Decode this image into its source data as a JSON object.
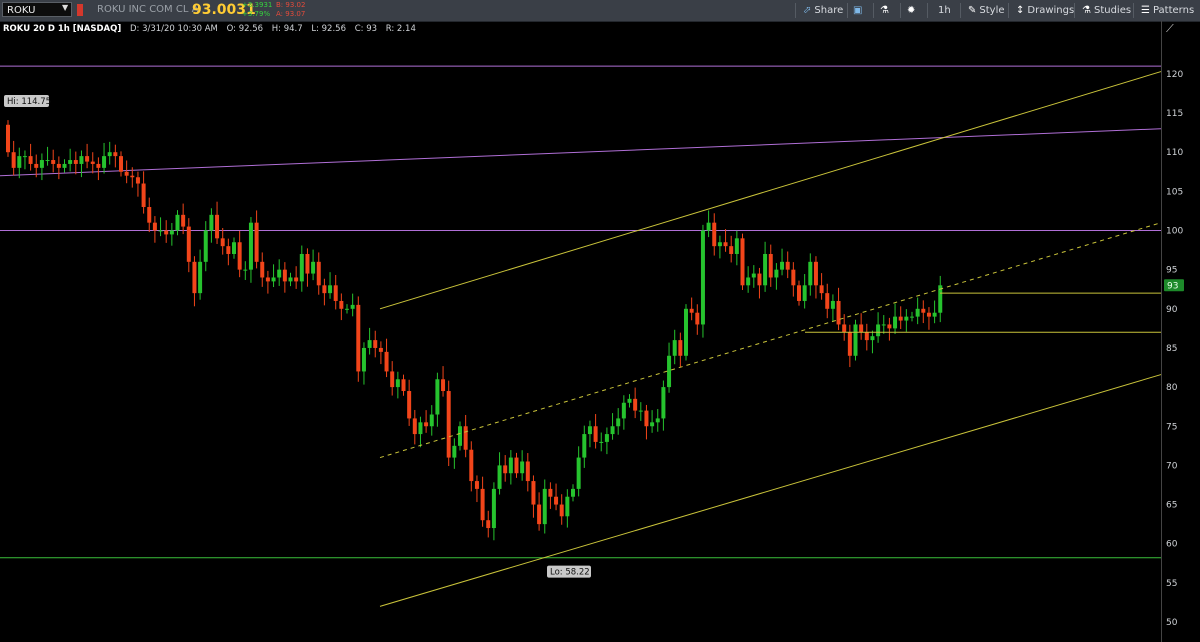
{
  "toolbar": {
    "symbol": "ROKU",
    "company": "ROKU INC COM CL A",
    "last_price": "93.0031",
    "change": "+3.3931",
    "change_pct": "+3.79%",
    "bid": "B: 93.02",
    "ask": "A: 93.07",
    "buttons": {
      "share": "Share",
      "timeframe": "1h",
      "style": "Style",
      "drawings": "Drawings",
      "studies": "Studies",
      "patterns": "Patterns"
    }
  },
  "infobar": {
    "title": "ROKU 20 D 1h [NASDAQ]",
    "date": "D: 3/31/20 10:30 AM",
    "open": "O: 92.56",
    "high": "H: 94.7",
    "low": "L: 92.56",
    "close": "C: 93",
    "range": "R: 2.14"
  },
  "colors": {
    "up": "#26c32e",
    "down": "#f2451a",
    "purple": "#b06fd6",
    "yellow": "#c9c33a",
    "green_line": "#3bbf3b"
  },
  "chart_data": {
    "type": "candlestick",
    "ylim": [
      48,
      124
    ],
    "y_ticks": [
      "50",
      "55",
      "60",
      "65",
      "70",
      "75",
      "80",
      "85",
      "90",
      "95",
      "100",
      "105",
      "110",
      "115",
      "120"
    ],
    "price_label": "93",
    "hi_label": "Hi: 114.75",
    "lo_label": "Lo: 58.22",
    "close": [
      110,
      108,
      109.5,
      109.5,
      108.5,
      108,
      109,
      109,
      108.5,
      108,
      108.5,
      109,
      108.5,
      109.5,
      108.8,
      108.5,
      108,
      109.5,
      110,
      109.5,
      107.5,
      107,
      106.8,
      106,
      103,
      101,
      100,
      100,
      99.5,
      100,
      102,
      100.5,
      96,
      92,
      96,
      100,
      102,
      99,
      98,
      97,
      98.5,
      95,
      95,
      101,
      96,
      94,
      93.5,
      94,
      95,
      93.5,
      94,
      93.5,
      97,
      94.5,
      96,
      93,
      92,
      93,
      91,
      90,
      90,
      90.5,
      82,
      85,
      86,
      85,
      84.5,
      82,
      80,
      81,
      79.5,
      76,
      74,
      75.5,
      75,
      76.5,
      81,
      79.5,
      71,
      72.5,
      75,
      72,
      68,
      67,
      63,
      62,
      67,
      70,
      69,
      71,
      69,
      70.5,
      68,
      65,
      62.5,
      67,
      66,
      65,
      63.5,
      66,
      67,
      71,
      74,
      75,
      73,
      73,
      74,
      75,
      76,
      78,
      78.5,
      77,
      77,
      75,
      75.5,
      76,
      80,
      84,
      86,
      84,
      90,
      89.5,
      88,
      100,
      101,
      98,
      98.5,
      98,
      97,
      99,
      93,
      94,
      94.5,
      93,
      97,
      94,
      95,
      96,
      95,
      93,
      91,
      93,
      96,
      93,
      92,
      90,
      91,
      88,
      87,
      84,
      88,
      87,
      86,
      86.5,
      88,
      88,
      87.5,
      89,
      88.5,
      89,
      89,
      90,
      89.5,
      89,
      89.5,
      93
    ],
    "low_label_value": 58.22,
    "high_label_value": 114.75
  }
}
